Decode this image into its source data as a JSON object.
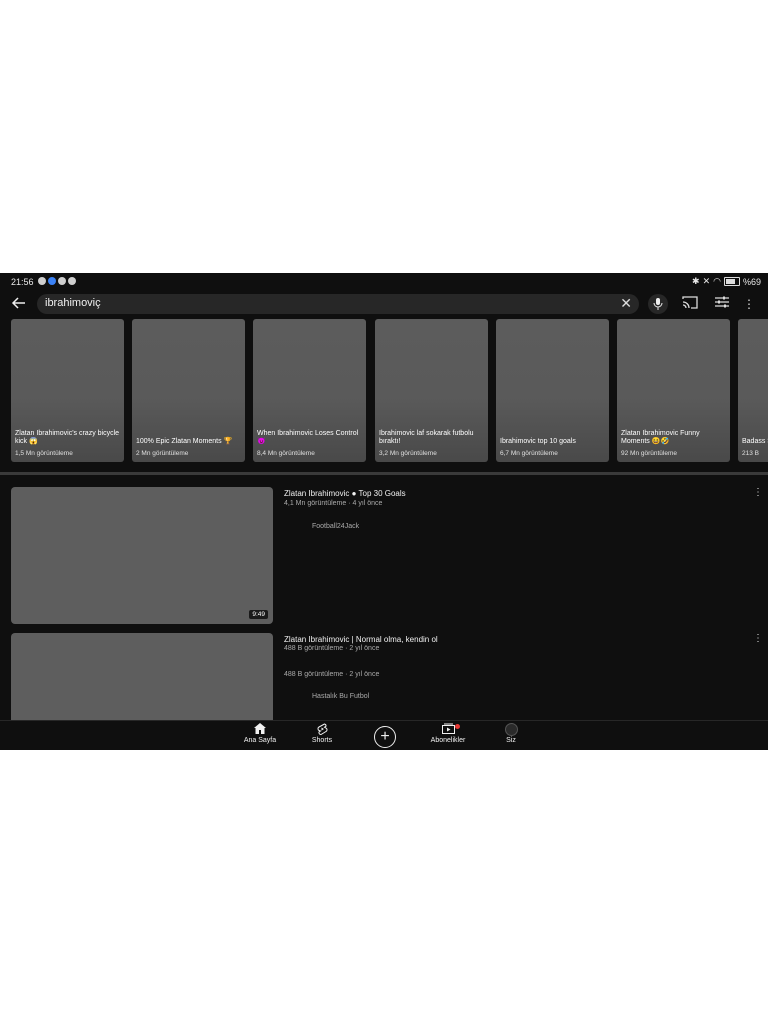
{
  "status_bar": {
    "time": "21:56",
    "battery": "%69"
  },
  "search": {
    "query": "ibrahimoviç"
  },
  "shorts": [
    {
      "title": "Zlatan Ibrahimovic's crazy bicycle kick 😱",
      "views": "1,5 Mn görüntüleme"
    },
    {
      "title": "100% Epic Zlatan Moments 🏆",
      "views": "2 Mn görüntüleme"
    },
    {
      "title": "When Ibrahimovic Loses Control 😈",
      "views": "8,4 Mn görüntüleme"
    },
    {
      "title": "Ibrahimovic laf sokarak futbolu bıraktı!",
      "views": "3,2 Mn görüntüleme"
    },
    {
      "title": "Ibrahimovic top 10 goals",
      "views": "6,7 Mn görüntüleme"
    },
    {
      "title": "Zlatan Ibrahimovic Funny Moments 😆🤣",
      "views": "92 Mn görüntüleme"
    },
    {
      "title": "Badass Savage",
      "views": "213 B"
    }
  ],
  "videos": [
    {
      "title": "Zlatan Ibrahimovic ● Top 30 Goals",
      "meta": "4,1 Mn görüntüleme · 4 yıl önce",
      "channel": "Football24Jack",
      "duration": "9:49"
    },
    {
      "title": "Zlatan Ibrahimovic | Normal olma, kendin ol",
      "meta": "488 B görüntüleme · 2 yıl önce",
      "meta2": "488 B görüntüleme · 2 yıl önce",
      "channel": "Hastalık Bu Futbol"
    }
  ],
  "nav": {
    "home": "Ana Sayfa",
    "shorts": "Shorts",
    "subscriptions": "Abonelikler",
    "you": "Siz"
  }
}
